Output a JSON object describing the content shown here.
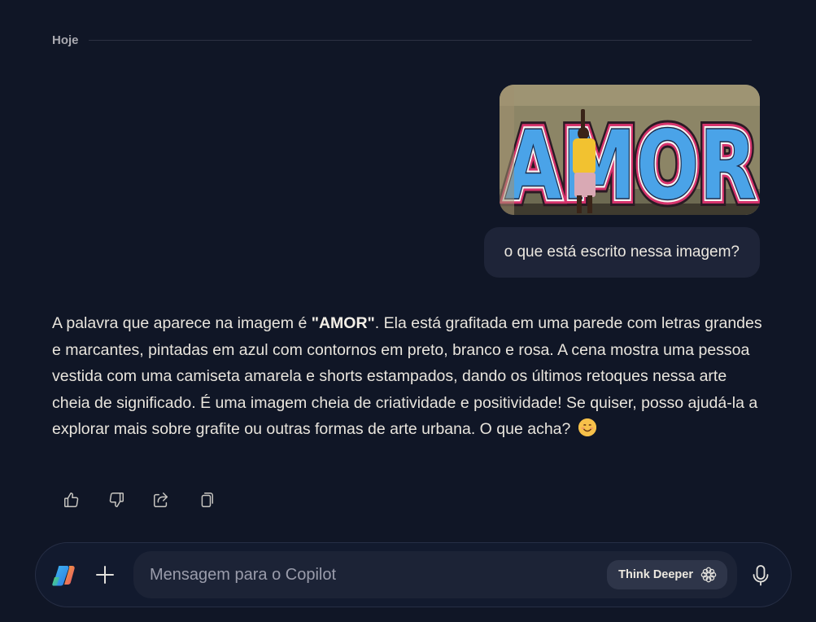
{
  "chat": {
    "day_label": "Hoje",
    "user_image": {
      "alt": "AMOR"
    },
    "user_message": "o que está escrito nessa imagem?",
    "assistant": {
      "part1": "A palavra que aparece na imagem é ",
      "bold": "\"AMOR\"",
      "part2": ". Ela está grafitada em uma parede com letras grandes e marcantes, pintadas em azul com contornos em preto, branco e rosa. A cena mostra uma pessoa vestida com uma camiseta amarela e shorts estampados, dando os últimos retoques nessa arte cheia de significado. É uma imagem cheia de criatividade e positividade! Se quiser, posso ajudá-la a explorar mais sobre grafite ou outras formas de arte urbana. O que acha? ",
      "emoji_icon": "smiling-face-emoji"
    },
    "actions": [
      {
        "name": "thumbs-up-icon"
      },
      {
        "name": "thumbs-down-icon"
      },
      {
        "name": "share-icon"
      },
      {
        "name": "copy-icon"
      }
    ]
  },
  "composer": {
    "placeholder": "Mensagem para o Copilot",
    "think_deeper_label": "Think Deeper",
    "icons": [
      "copilot-logo-icon",
      "plus-icon",
      "think-deeper-icon",
      "microphone-icon"
    ]
  },
  "colors": {
    "background": "#101626",
    "user_bubble": "#1e2438",
    "composer_bg": "#121a2e",
    "input_bg": "#1c2336",
    "graffiti_blue": "#4aa3e8",
    "graffiti_pink": "#d6336c",
    "shirt_yellow": "#f2c230"
  }
}
